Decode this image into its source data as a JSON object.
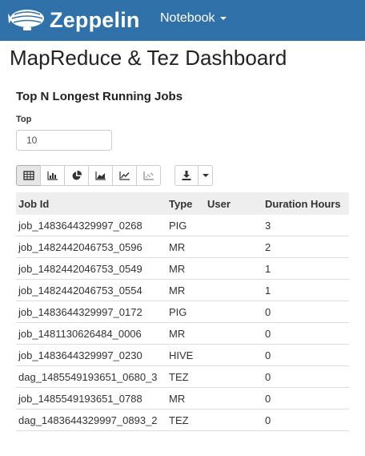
{
  "navbar": {
    "brand": "Zeppelin",
    "menu_label": "Notebook"
  },
  "page": {
    "title": "MapReduce & Tez Dashboard"
  },
  "paragraph": {
    "title": "Top N Longest Running Jobs",
    "top_label": "Top",
    "top_value": "10"
  },
  "toolbar": {
    "visualizations": [
      {
        "icon": "table-icon",
        "active": true
      },
      {
        "icon": "bar-chart-icon",
        "active": false
      },
      {
        "icon": "pie-chart-icon",
        "active": false
      },
      {
        "icon": "area-chart-icon",
        "active": false
      },
      {
        "icon": "line-chart-icon",
        "active": false
      },
      {
        "icon": "scatter-chart-icon",
        "active": false
      }
    ],
    "download_icon": "download-icon",
    "dropdown_icon": "caret-down-icon"
  },
  "table": {
    "headers": [
      "Job Id",
      "Type",
      "User",
      "Duration Hours"
    ],
    "rows": [
      [
        "job_1483644329997_0268",
        "PIG",
        "",
        "3"
      ],
      [
        "job_1482442046753_0596",
        "MR",
        "",
        "2"
      ],
      [
        "job_1482442046753_0549",
        "MR",
        "",
        "1"
      ],
      [
        "job_1482442046753_0554",
        "MR",
        "",
        "1"
      ],
      [
        "job_1483644329997_0172",
        "PIG",
        "",
        "0"
      ],
      [
        "job_1481130626484_0006",
        "MR",
        "",
        "0"
      ],
      [
        "job_1483644329997_0230",
        "HIVE",
        "",
        "0"
      ],
      [
        "dag_1485549193651_0680_3",
        "TEZ",
        "",
        "0"
      ],
      [
        "job_1485549193651_0788",
        "MR",
        "",
        "0"
      ],
      [
        "dag_1483644329997_0893_2",
        "TEZ",
        "",
        "0"
      ]
    ]
  },
  "colors": {
    "navbar": "#3071a9",
    "header_row": "#eeeeee"
  }
}
